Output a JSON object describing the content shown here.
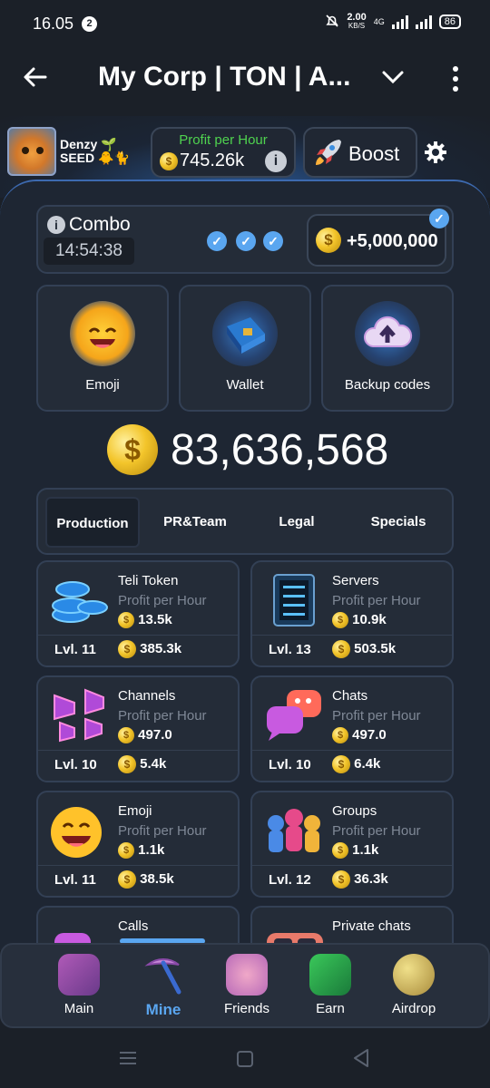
{
  "status": {
    "time": "16.05",
    "notif_count": "2",
    "net_speed": "2.00",
    "net_unit": "KB/S",
    "net_type": "4G",
    "battery": "86"
  },
  "header": {
    "title": "My Corp | TON | A..."
  },
  "profile": {
    "name": "Denzy",
    "tag": "SEED",
    "badges": "🌱 🐥🐈"
  },
  "profit": {
    "label": "Profit per Hour",
    "value": "745.26k"
  },
  "boost": {
    "label": "Boost"
  },
  "combo": {
    "label": "Combo",
    "timer": "14:54:38",
    "reward": "+5,000,000"
  },
  "tiles": [
    {
      "label": "Emoji"
    },
    {
      "label": "Wallet"
    },
    {
      "label": "Backup codes"
    }
  ],
  "balance": "83,636,568",
  "tabs": [
    {
      "label": "Production",
      "active": true
    },
    {
      "label": "PR&Team"
    },
    {
      "label": "Legal"
    },
    {
      "label": "Specials"
    }
  ],
  "items": [
    {
      "name": "Teli Token",
      "sub": "Profit per Hour",
      "pph": "13.5k",
      "level": "Lvl. 11",
      "cost": "385.3k"
    },
    {
      "name": "Servers",
      "sub": "Profit per Hour",
      "pph": "10.9k",
      "level": "Lvl. 13",
      "cost": "503.5k"
    },
    {
      "name": "Channels",
      "sub": "Profit per Hour",
      "pph": "497.0",
      "level": "Lvl. 10",
      "cost": "5.4k"
    },
    {
      "name": "Chats",
      "sub": "Profit per Hour",
      "pph": "497.0",
      "level": "Lvl. 10",
      "cost": "6.4k"
    },
    {
      "name": "Emoji",
      "sub": "Profit per Hour",
      "pph": "1.1k",
      "level": "Lvl. 11",
      "cost": "38.5k"
    },
    {
      "name": "Groups",
      "sub": "Profit per Hour",
      "pph": "1.1k",
      "level": "Lvl. 12",
      "cost": "36.3k"
    },
    {
      "name": "Calls"
    },
    {
      "name": "Private chats"
    }
  ],
  "nav": [
    {
      "label": "Main"
    },
    {
      "label": "Mine",
      "active": true
    },
    {
      "label": "Friends"
    },
    {
      "label": "Earn"
    },
    {
      "label": "Airdrop"
    }
  ],
  "colors": {
    "accent": "#5aa6f0",
    "profit_green": "#4fd34f",
    "coin_gold": "#f3c52b",
    "panel": "#1e2633"
  }
}
